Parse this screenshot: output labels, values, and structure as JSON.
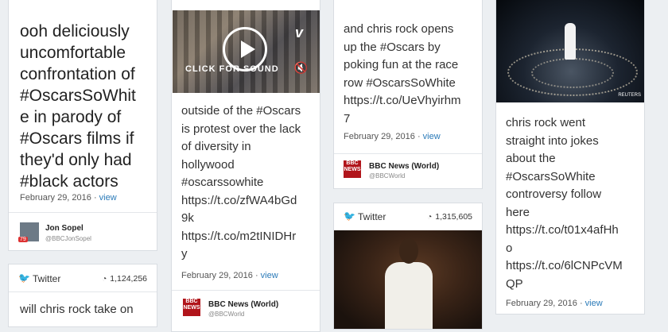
{
  "col1": {
    "card1": {
      "lines": [
        "ooh deliciously",
        "uncomfortable",
        "confrontation of",
        "#OscarsSoWhit",
        "e in parody of",
        "#Oscars films if",
        "they'd only had",
        "#black actors"
      ],
      "date": "February 29, 2016",
      "view": "view",
      "author_name": "Jon Sopel",
      "author_handle": "@BBCJonSopel",
      "badge": "79"
    },
    "card2": {
      "source": "Twitter",
      "count": "1,124,256",
      "lines": [
        "will chris rock take on"
      ]
    }
  },
  "col2": {
    "card1": {
      "video_caption": "CLICK FOR SOUND",
      "lines": [
        "outside of the #Oscars",
        "is protest over the lack",
        "of diversity in",
        "hollywood",
        "#oscarssowhite",
        "https://t.co/zfWA4bGd",
        "9k",
        "https://t.co/m2tINIDHr",
        "y"
      ],
      "date": "February 29, 2016",
      "view": "view",
      "author_name": "BBC News (World)",
      "author_handle": "@BBCWorld"
    }
  },
  "col3": {
    "card1": {
      "lines": [
        "and chris rock opens",
        "up the #Oscars by",
        "poking fun at the race",
        "row #OscarsSoWhite",
        "https://t.co/UeVhyirhm",
        "7"
      ],
      "date": "February 29, 2016",
      "view": "view",
      "author_name": "BBC News (World)",
      "author_handle": "@BBCWorld"
    },
    "card2": {
      "source": "Twitter",
      "count": "1,315,605"
    }
  },
  "col4": {
    "card1": {
      "watermark": "REUTERS",
      "lines": [
        "chris rock went",
        "straight into jokes",
        "about the",
        "#OscarsSoWhite",
        "controversy follow",
        "here",
        "https://t.co/t01x4afHh",
        "o",
        "https://t.co/6lCNPcVM",
        "QP"
      ],
      "date": "February 29, 2016",
      "view": "view"
    }
  },
  "bbc_logo": "BBC NEWS",
  "colors": {
    "link": "#2a7ab8",
    "twitter": "#1da1f2",
    "bbc": "#b1151b"
  }
}
